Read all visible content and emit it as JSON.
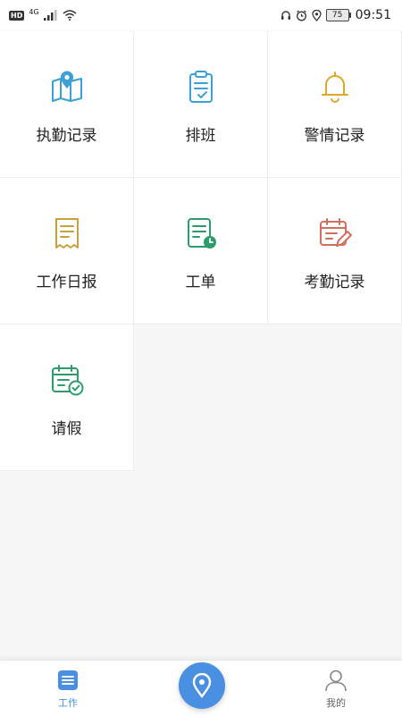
{
  "status_bar": {
    "hd": "HD",
    "network": "4G",
    "battery": "75",
    "time": "09:51"
  },
  "grid": {
    "items": [
      {
        "label": "执勤记录",
        "icon": "map-pin-icon",
        "color": "#3aa0d6"
      },
      {
        "label": "排班",
        "icon": "clipboard-icon",
        "color": "#3aa0d6"
      },
      {
        "label": "警情记录",
        "icon": "bell-icon",
        "color": "#e0a72a"
      },
      {
        "label": "工作日报",
        "icon": "receipt-icon",
        "color": "#c9a13c"
      },
      {
        "label": "工单",
        "icon": "document-clock-icon",
        "color": "#2e9c6a"
      },
      {
        "label": "考勤记录",
        "icon": "calendar-edit-icon",
        "color": "#d0705c"
      },
      {
        "label": "请假",
        "icon": "calendar-check-icon",
        "color": "#2e9c6a"
      }
    ]
  },
  "bottom_nav": {
    "work_label": "工作",
    "mine_label": "我的",
    "active_color": "#4a90e2"
  }
}
